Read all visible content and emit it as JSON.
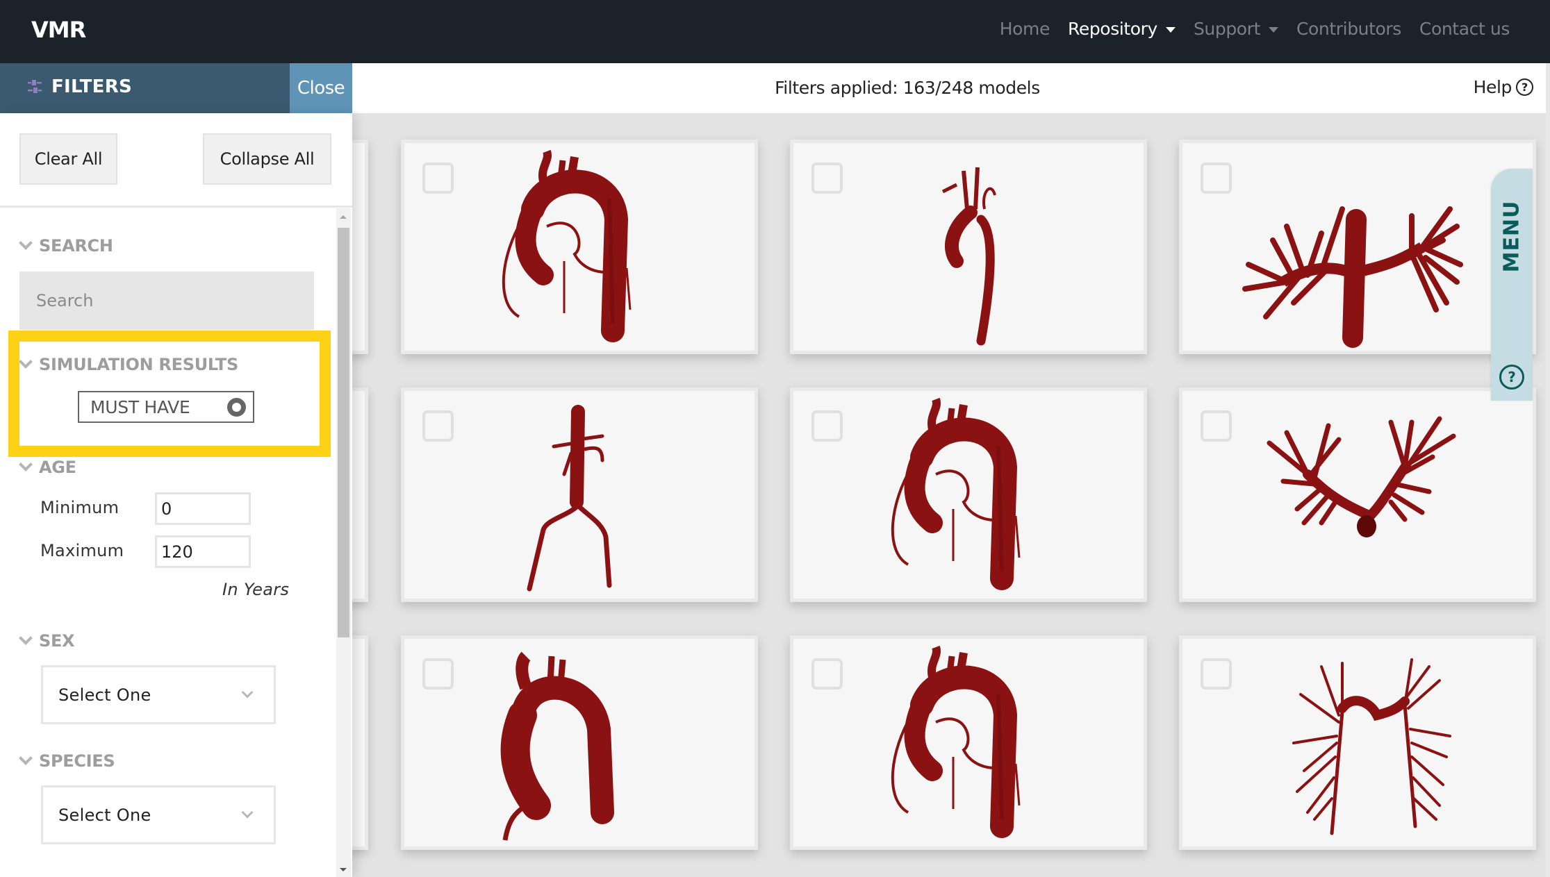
{
  "navbar": {
    "brand": "VMR",
    "items": [
      {
        "label": "Home",
        "active": false,
        "dropdown": false
      },
      {
        "label": "Repository",
        "active": true,
        "dropdown": true
      },
      {
        "label": "Support",
        "active": false,
        "dropdown": true
      },
      {
        "label": "Contributors",
        "active": false,
        "dropdown": false
      },
      {
        "label": "Contact us",
        "active": false,
        "dropdown": false
      }
    ]
  },
  "filters_panel": {
    "title": "FILTERS",
    "close_label": "Close",
    "clear_all_label": "Clear All",
    "collapse_all_label": "Collapse All",
    "sections": {
      "search": {
        "title": "SEARCH",
        "placeholder": "Search",
        "value": ""
      },
      "simulation_results": {
        "title": "SIMULATION RESULTS",
        "toggle_label": "MUST HAVE",
        "toggle_on": false,
        "highlighted": true
      },
      "age": {
        "title": "AGE",
        "min_label": "Minimum",
        "min_value": "0",
        "max_label": "Maximum",
        "max_value": "120",
        "unit_note": "In Years"
      },
      "sex": {
        "title": "SEX",
        "selected": "Select One"
      },
      "species": {
        "title": "SPECIES",
        "selected": "Select One"
      }
    }
  },
  "results_bar": {
    "summary": "Filters applied: 163/248 models",
    "filtered_count": 163,
    "total_count": 248,
    "help_label": "Help"
  },
  "side_menu": {
    "label": "MENU"
  },
  "model_grid": {
    "columns": 3,
    "rows": 3,
    "cards": [
      {
        "kind": "aortic-arch-coronary",
        "selected": false
      },
      {
        "kind": "thin-aorta-branches",
        "selected": false
      },
      {
        "kind": "pulmonary-tree-trunk",
        "selected": false
      },
      {
        "kind": "abdominal-aorta-iliac",
        "selected": false
      },
      {
        "kind": "aortic-arch-coronary",
        "selected": false
      },
      {
        "kind": "pulmonary-tree-v",
        "selected": false
      },
      {
        "kind": "aortic-arch-thick",
        "selected": false
      },
      {
        "kind": "aortic-arch-coronary",
        "selected": false
      },
      {
        "kind": "pulmonary-tree-fine",
        "selected": false
      }
    ]
  },
  "colors": {
    "navbar_bg": "#1b2229",
    "filters_header_bg": "#3c5a6f",
    "close_button_bg": "#6094b7",
    "highlight_border": "#fdd116",
    "model_red": "#8b1212",
    "menu_tab_bg": "#c5dde2",
    "menu_tab_text": "#0b5a5c"
  }
}
